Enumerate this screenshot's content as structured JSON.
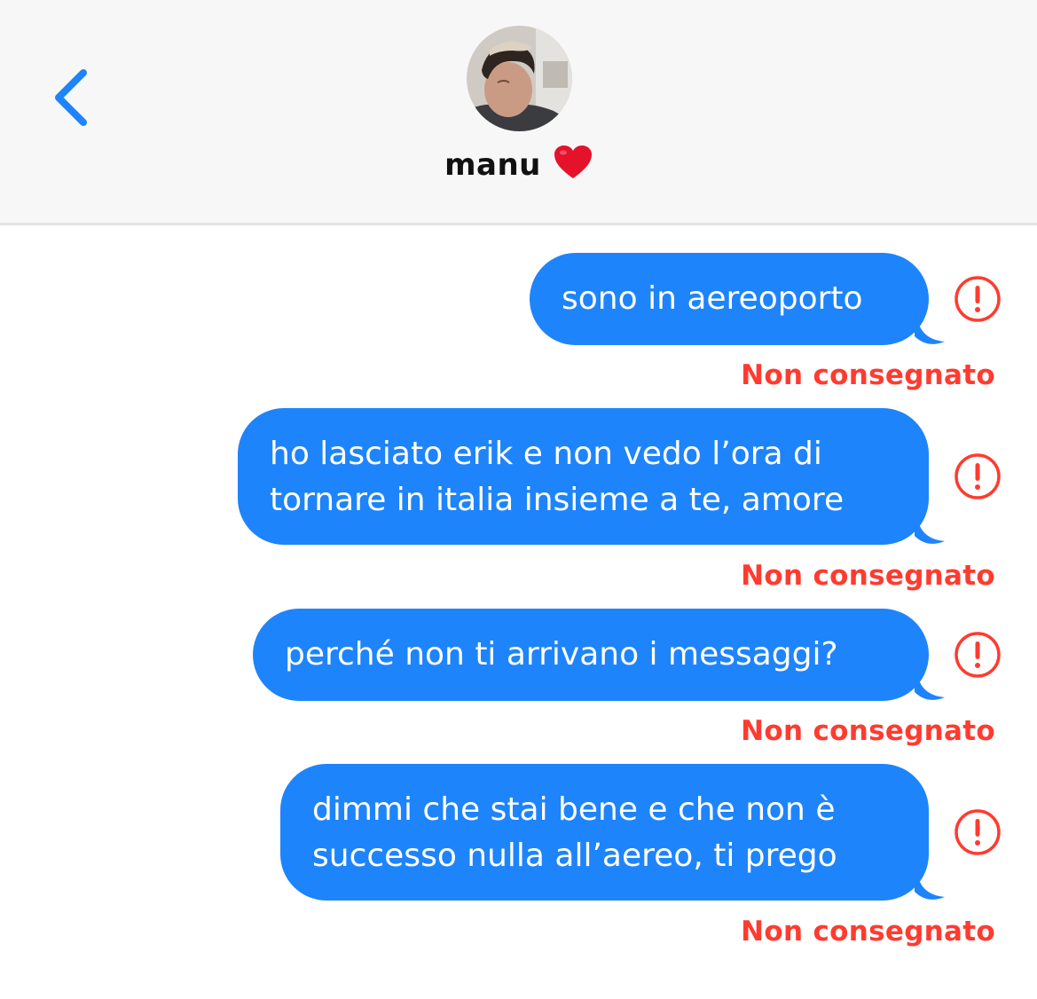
{
  "header": {
    "contact_name": "manu",
    "heart_emoji": "❤️",
    "back_icon": "chevron-left-icon",
    "accent_color": "#1e84fb"
  },
  "messages": [
    {
      "text": "sono in aereoporto",
      "status": "Non consegnato",
      "error_icon": "exclamation-circle-icon"
    },
    {
      "text": "ho lasciato erik e non vedo l’ora di\ntornare in italia insieme a te, amore",
      "status": "Non consegnato",
      "error_icon": "exclamation-circle-icon"
    },
    {
      "text": "perché non ti arrivano i messaggi?",
      "status": "Non consegnato",
      "error_icon": "exclamation-circle-icon"
    },
    {
      "text": "dimmi che stai bene e che non è\nsuccesso nulla all’aereo, ti prego",
      "status": "Non consegnato",
      "error_icon": "exclamation-circle-icon"
    }
  ],
  "colors": {
    "bubble": "#1e84fb",
    "error": "#ff3b30",
    "header_bg": "#f7f7f7"
  }
}
